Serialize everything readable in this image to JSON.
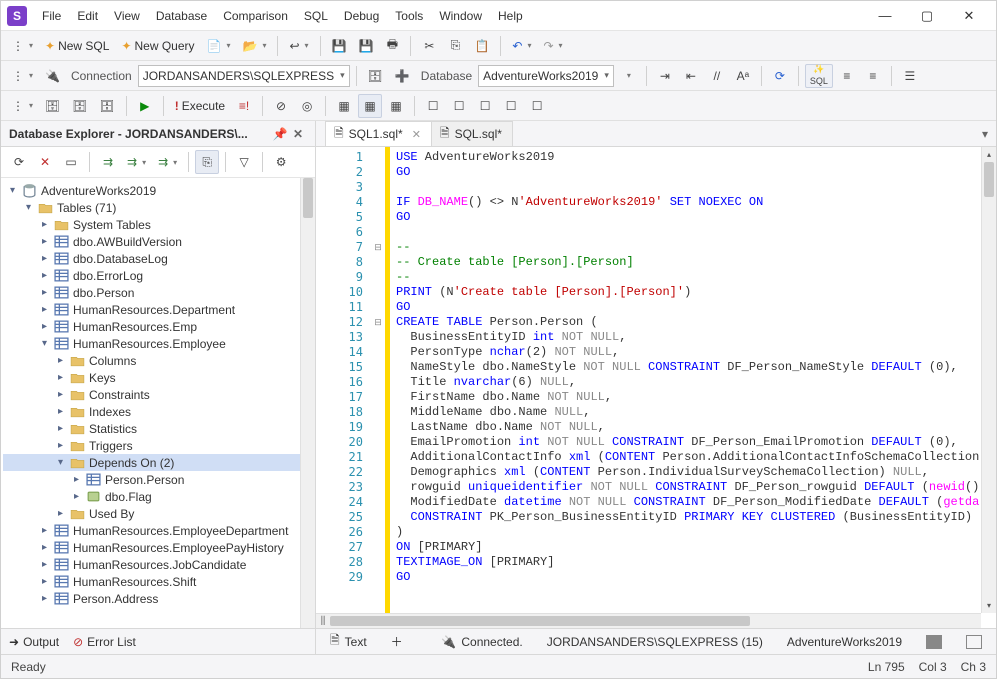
{
  "menu": [
    "File",
    "Edit",
    "View",
    "Database",
    "Comparison",
    "SQL",
    "Debug",
    "Tools",
    "Window",
    "Help"
  ],
  "toolbar1": {
    "newsql": "New SQL",
    "newquery": "New Query"
  },
  "toolbar2": {
    "connection_label": "Connection",
    "connection_value": "JORDANSANDERS\\SQLEXPRESS",
    "database_label": "Database",
    "database_value": "AdventureWorks2019",
    "sql_btn": "SQL"
  },
  "toolbar3": {
    "execute": "Execute"
  },
  "explorer": {
    "title": "Database Explorer - JORDANSANDERS\\...",
    "root": "AdventureWorks2019",
    "tables_label": "Tables (71)",
    "items": [
      "System Tables",
      "dbo.AWBuildVersion",
      "dbo.DatabaseLog",
      "dbo.ErrorLog",
      "dbo.Person",
      "HumanResources.Department",
      "HumanResources.Emp",
      "HumanResources.Employee"
    ],
    "employee_children": [
      "Columns",
      "Keys",
      "Constraints",
      "Indexes",
      "Statistics",
      "Triggers"
    ],
    "depends_label": "Depends On (2)",
    "depends_children": [
      "Person.Person",
      "dbo.Flag"
    ],
    "used_by": "Used By",
    "rest": [
      "HumanResources.EmployeeDepartment",
      "HumanResources.EmployeePayHistory",
      "HumanResources.JobCandidate",
      "HumanResources.Shift",
      "Person.Address"
    ]
  },
  "tabs": {
    "t1": "SQL1.sql*",
    "t2": "SQL.sql*"
  },
  "code_lines": {
    "start": 1,
    "lines": [
      {
        "t": "<span class='kw'>USE</span> AdventureWorks2019"
      },
      {
        "t": "<span class='kw'>GO</span>"
      },
      {
        "t": ""
      },
      {
        "t": "<span class='kw'>IF</span> <span class='fn'>DB_NAME</span>() &lt;&gt; N<span class='str'>'AdventureWorks2019'</span> <span class='kw'>SET</span> <span class='kw'>NOEXEC</span> <span class='kw'>ON</span>"
      },
      {
        "t": "<span class='kw'>GO</span>"
      },
      {
        "t": ""
      },
      {
        "t": "<span class='cmt'>--</span>"
      },
      {
        "t": "<span class='cmt'>-- Create table [Person].[Person]</span>"
      },
      {
        "t": "<span class='cmt'>--</span>"
      },
      {
        "t": "<span class='kw'>PRINT</span> (N<span class='str'>'Create table [Person].[Person]'</span>)"
      },
      {
        "t": "<span class='kw'>GO</span>"
      },
      {
        "t": "<span class='kw'>CREATE</span> <span class='kw'>TABLE</span> Person.Person ("
      },
      {
        "t": "  BusinessEntityID <span class='kw'>int</span> <span class='gray'>NOT NULL</span>,"
      },
      {
        "t": "  PersonType <span class='kw'>nchar</span>(2) <span class='gray'>NOT NULL</span>,"
      },
      {
        "t": "  NameStyle dbo.NameStyle <span class='gray'>NOT NULL</span> <span class='kw'>CONSTRAINT</span> DF_Person_NameStyle <span class='kw'>DEFAULT</span> (0),"
      },
      {
        "t": "  Title <span class='kw'>nvarchar</span>(6) <span class='gray'>NULL</span>,"
      },
      {
        "t": "  FirstName dbo.Name <span class='gray'>NOT NULL</span>,"
      },
      {
        "t": "  MiddleName dbo.Name <span class='gray'>NULL</span>,"
      },
      {
        "t": "  LastName dbo.Name <span class='gray'>NOT NULL</span>,"
      },
      {
        "t": "  EmailPromotion <span class='kw'>int</span> <span class='gray'>NOT NULL</span> <span class='kw'>CONSTRAINT</span> DF_Person_EmailPromotion <span class='kw'>DEFAULT</span> (0),"
      },
      {
        "t": "  AdditionalContactInfo <span class='kw'>xml</span> (<span class='kw'>CONTENT</span> Person.AdditionalContactInfoSchemaCollection"
      },
      {
        "t": "  Demographics <span class='kw'>xml</span> (<span class='kw'>CONTENT</span> Person.IndividualSurveySchemaCollection) <span class='gray'>NULL</span>,"
      },
      {
        "t": "  rowguid <span class='kw'>uniqueidentifier</span> <span class='gray'>NOT NULL</span> <span class='kw'>CONSTRAINT</span> DF_Person_rowguid <span class='kw'>DEFAULT</span> (<span class='fn'>newid</span>()"
      },
      {
        "t": "  ModifiedDate <span class='kw'>datetime</span> <span class='gray'>NOT NULL</span> <span class='kw'>CONSTRAINT</span> DF_Person_ModifiedDate <span class='kw'>DEFAULT</span> (<span class='fn'>getda</span>"
      },
      {
        "t": "  <span class='kw'>CONSTRAINT</span> PK_Person_BusinessEntityID <span class='kw'>PRIMARY</span> <span class='kw'>KEY</span> <span class='kw'>CLUSTERED</span> (BusinessEntityID)"
      },
      {
        "t": ")"
      },
      {
        "t": "<span class='kw'>ON</span> [PRIMARY]"
      },
      {
        "t": "<span class='kw'>TEXTIMAGE_ON</span> [PRIMARY]"
      },
      {
        "t": "<span class='kw'>GO</span>"
      }
    ]
  },
  "editor_status": {
    "text": "Text",
    "connected": "Connected.",
    "server": "JORDANSANDERS\\SQLEXPRESS (15)",
    "db": "AdventureWorks2019"
  },
  "bottom_tabs": {
    "output": "Output",
    "errors": "Error List"
  },
  "status": {
    "ready": "Ready",
    "ln": "Ln 795",
    "col": "Col 3",
    "ch": "Ch 3"
  }
}
